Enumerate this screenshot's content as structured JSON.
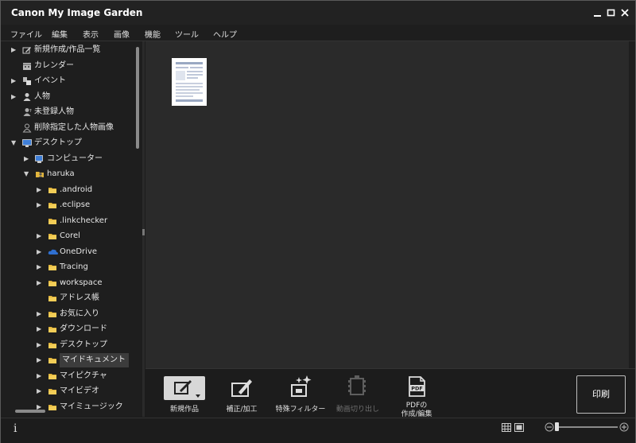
{
  "window": {
    "title": "Canon My Image Garden"
  },
  "menu": [
    "ファイル",
    "編集",
    "表示",
    "画像",
    "機能",
    "ツール",
    "ヘルプ"
  ],
  "tree": [
    {
      "label": "新規作成/作品一覧",
      "icon": "new-work-icon",
      "arrow": "▶",
      "indent": 0
    },
    {
      "label": "カレンダー",
      "icon": "calendar-icon",
      "arrow": "",
      "indent": 0
    },
    {
      "label": "イベント",
      "icon": "event-icon",
      "arrow": "▶",
      "indent": 0
    },
    {
      "label": "人物",
      "icon": "person-icon",
      "arrow": "▶",
      "indent": 0
    },
    {
      "label": "未登録人物",
      "icon": "unregistered-person-icon",
      "arrow": "",
      "indent": 0
    },
    {
      "label": "削除指定した人物画像",
      "icon": "deleted-person-icon",
      "arrow": "",
      "indent": 0
    },
    {
      "label": "デスクトップ",
      "icon": "desktop-icon",
      "arrow": "▼",
      "indent": 0
    },
    {
      "label": "コンピューター",
      "icon": "computer-icon",
      "arrow": "▶",
      "indent": 1
    },
    {
      "label": "haruka",
      "icon": "user-folder-icon",
      "arrow": "▼",
      "indent": 1
    },
    {
      "label": ".android",
      "icon": "folder-icon",
      "arrow": "▶",
      "indent": 2
    },
    {
      "label": ".eclipse",
      "icon": "folder-icon",
      "arrow": "▶",
      "indent": 2
    },
    {
      "label": ".linkchecker",
      "icon": "folder-icon",
      "arrow": "",
      "indent": 2
    },
    {
      "label": "Corel",
      "icon": "folder-icon",
      "arrow": "▶",
      "indent": 2
    },
    {
      "label": "OneDrive",
      "icon": "cloud-icon",
      "arrow": "▶",
      "indent": 2
    },
    {
      "label": "Tracing",
      "icon": "folder-icon",
      "arrow": "▶",
      "indent": 2
    },
    {
      "label": "workspace",
      "icon": "folder-icon",
      "arrow": "▶",
      "indent": 2
    },
    {
      "label": "アドレス帳",
      "icon": "folder-icon",
      "arrow": "",
      "indent": 2
    },
    {
      "label": "お気に入り",
      "icon": "folder-icon",
      "arrow": "▶",
      "indent": 2
    },
    {
      "label": "ダウンロード",
      "icon": "folder-icon",
      "arrow": "▶",
      "indent": 2
    },
    {
      "label": "デスクトップ",
      "icon": "folder-icon",
      "arrow": "▶",
      "indent": 2
    },
    {
      "label": "マイドキュメント",
      "icon": "folder-icon",
      "arrow": "▶",
      "indent": 2,
      "selected": true
    },
    {
      "label": "マイピクチャ",
      "icon": "folder-icon",
      "arrow": "▶",
      "indent": 2
    },
    {
      "label": "マイビデオ",
      "icon": "folder-icon",
      "arrow": "▶",
      "indent": 2
    },
    {
      "label": "マイミュージック",
      "icon": "folder-icon",
      "arrow": "▶",
      "indent": 2
    }
  ],
  "tools": [
    {
      "label": "新規作品",
      "icon": "new-work-tool-icon",
      "disabled": false
    },
    {
      "label": "補正/加工",
      "icon": "correct-edit-icon",
      "disabled": false
    },
    {
      "label": "特殊フィルター",
      "icon": "special-filter-icon",
      "disabled": false
    },
    {
      "label": "動画切り出し",
      "icon": "video-capture-icon",
      "disabled": true
    },
    {
      "label": "PDFの\n作成/編集",
      "icon": "pdf-icon",
      "disabled": false
    }
  ],
  "print_label": "印刷",
  "status": {
    "info_label": "i"
  }
}
